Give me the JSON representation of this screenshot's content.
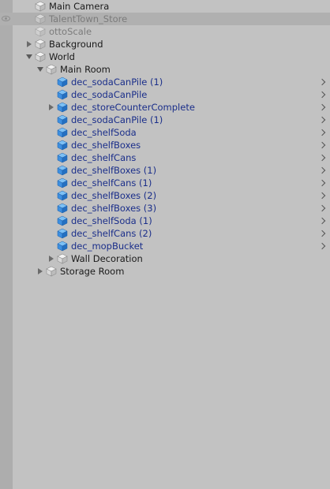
{
  "hierarchy": {
    "items": [
      {
        "label": "Main Camera",
        "depth": 0,
        "kind": "normal",
        "fold": "none",
        "prefab_arrow": false
      },
      {
        "label": "TalentTown_Store",
        "depth": 0,
        "kind": "disabled",
        "fold": "none",
        "prefab_arrow": false,
        "selected": true,
        "visibility_icon": "eye-icon"
      },
      {
        "label": "ottoScale",
        "depth": 0,
        "kind": "disabled",
        "fold": "none",
        "prefab_arrow": false
      },
      {
        "label": "Background",
        "depth": 0,
        "kind": "normal",
        "fold": "collapsed",
        "prefab_arrow": false
      },
      {
        "label": "World",
        "depth": 0,
        "kind": "normal",
        "fold": "expanded",
        "prefab_arrow": false
      },
      {
        "label": "Main Room",
        "depth": 1,
        "kind": "normal",
        "fold": "expanded",
        "prefab_arrow": false
      },
      {
        "label": "dec_sodaCanPile (1)",
        "depth": 2,
        "kind": "prefab",
        "fold": "none",
        "prefab_arrow": true
      },
      {
        "label": "dec_sodaCanPile",
        "depth": 2,
        "kind": "prefab",
        "fold": "none",
        "prefab_arrow": true
      },
      {
        "label": "dec_storeCounterComplete",
        "depth": 2,
        "kind": "prefab",
        "fold": "collapsed",
        "prefab_arrow": true
      },
      {
        "label": "dec_sodaCanPile (1)",
        "depth": 2,
        "kind": "prefab",
        "fold": "none",
        "prefab_arrow": true
      },
      {
        "label": "dec_shelfSoda",
        "depth": 2,
        "kind": "prefab",
        "fold": "none",
        "prefab_arrow": true
      },
      {
        "label": "dec_shelfBoxes",
        "depth": 2,
        "kind": "prefab",
        "fold": "none",
        "prefab_arrow": true
      },
      {
        "label": "dec_shelfCans",
        "depth": 2,
        "kind": "prefab",
        "fold": "none",
        "prefab_arrow": true
      },
      {
        "label": "dec_shelfBoxes (1)",
        "depth": 2,
        "kind": "prefab",
        "fold": "none",
        "prefab_arrow": true
      },
      {
        "label": "dec_shelfCans (1)",
        "depth": 2,
        "kind": "prefab",
        "fold": "none",
        "prefab_arrow": true
      },
      {
        "label": "dec_shelfBoxes (2)",
        "depth": 2,
        "kind": "prefab",
        "fold": "none",
        "prefab_arrow": true
      },
      {
        "label": "dec_shelfBoxes (3)",
        "depth": 2,
        "kind": "prefab",
        "fold": "none",
        "prefab_arrow": true
      },
      {
        "label": "dec_shelfSoda (1)",
        "depth": 2,
        "kind": "prefab",
        "fold": "none",
        "prefab_arrow": true
      },
      {
        "label": "dec_shelfCans (2)",
        "depth": 2,
        "kind": "prefab",
        "fold": "none",
        "prefab_arrow": true
      },
      {
        "label": "dec_mopBucket",
        "depth": 2,
        "kind": "prefab",
        "fold": "none",
        "prefab_arrow": true
      },
      {
        "label": "Wall Decoration",
        "depth": 2,
        "kind": "normal",
        "fold": "collapsed",
        "prefab_arrow": false
      },
      {
        "label": "Storage Room",
        "depth": 1,
        "kind": "normal",
        "fold": "collapsed",
        "prefab_arrow": false
      }
    ]
  },
  "colors": {
    "background": "#c2c2c2",
    "gutter": "#adadad",
    "selected_row": "#b0b0b0",
    "prefab_text": "#1a2e8a",
    "normal_text": "#1a1a1a",
    "disabled_text": "#7b7b7b",
    "prefab_cube": "#3d8fe0",
    "gameobject_cube": "#e6e6e6"
  }
}
